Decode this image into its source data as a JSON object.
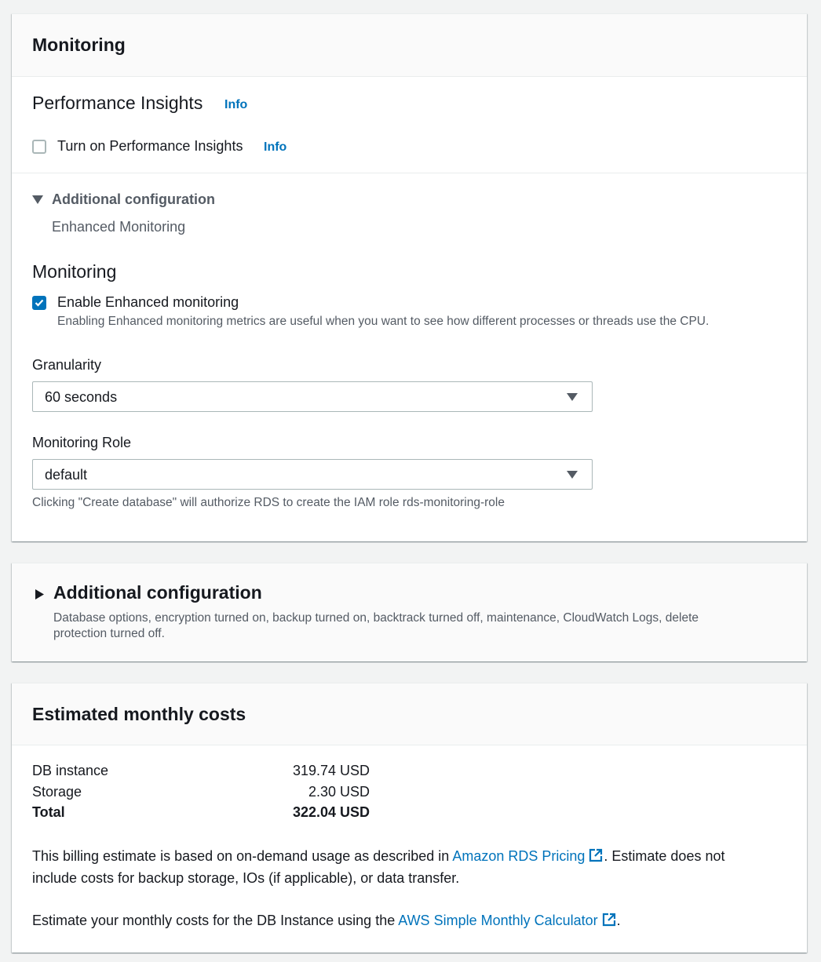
{
  "monitoring_panel": {
    "title": "Monitoring",
    "perf_insights_heading": "Performance Insights",
    "perf_insights_info": "Info",
    "turn_on_label": "Turn on Performance Insights",
    "turn_on_info": "Info",
    "turn_on_checked": false,
    "additional_config_label": "Additional configuration",
    "enhanced_monitoring_label": "Enhanced Monitoring",
    "monitoring_heading": "Monitoring",
    "enable_enhanced_label": "Enable Enhanced monitoring",
    "enable_enhanced_checked": true,
    "enable_enhanced_desc": "Enabling Enhanced monitoring metrics are useful when you want to see how different processes or threads use the CPU.",
    "granularity_label": "Granularity",
    "granularity_value": "60 seconds",
    "monitoring_role_label": "Monitoring Role",
    "monitoring_role_value": "default",
    "monitoring_role_hint": "Clicking \"Create database\" will authorize RDS to create the IAM role rds-monitoring-role"
  },
  "additional_config_panel": {
    "title": "Additional configuration",
    "desc_line1": "Database options, encryption turned on, backup turned on, backtrack turned off, maintenance, CloudWatch Logs, delete",
    "desc_line2": "protection turned off."
  },
  "costs_panel": {
    "title": "Estimated monthly costs",
    "rows": [
      {
        "label": "DB instance",
        "value": "319.74 USD"
      },
      {
        "label": "Storage",
        "value": "2.30 USD"
      },
      {
        "label": "Total",
        "value": "322.04 USD"
      }
    ],
    "billing_text_1": "This billing estimate is based on on-demand usage as described in ",
    "billing_link": "Amazon RDS Pricing",
    "billing_text_2": ". Estimate does not",
    "billing_text_3": "include costs for backup storage, IOs (if applicable), or data transfer.",
    "calc_text_1": "Estimate your monthly costs for the DB Instance using the ",
    "calc_link": "AWS Simple Monthly Calculator",
    "calc_text_2": "."
  },
  "colors": {
    "link": "#0073bb",
    "checkbox_checked": "#0073bb",
    "page_bg": "#f2f3f3"
  }
}
